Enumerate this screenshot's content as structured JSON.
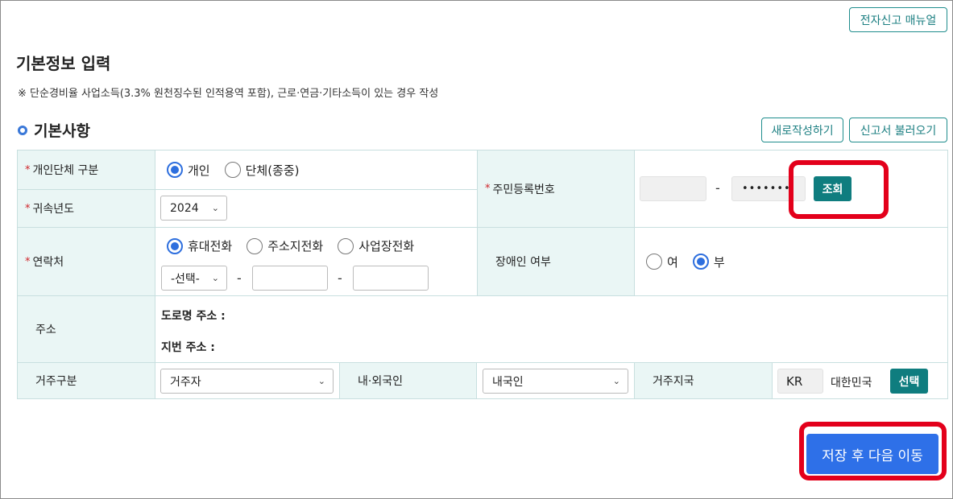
{
  "header": {
    "manual_button": "전자신고 매뉴얼"
  },
  "page": {
    "title": "기본정보 입력",
    "note": "※ 단순경비율 사업소득(3.3% 원천징수된 인적용역 포함), 근로·연금·기타소득이 있는 경우 작성"
  },
  "section": {
    "title": "기본사항",
    "new_button": "새로작성하기",
    "load_button": "신고서 불러오기"
  },
  "form": {
    "required_mark": "*",
    "person_type": {
      "label": "개인단체 구분",
      "options": [
        "개인",
        "단체(종중)"
      ],
      "selected": "개인"
    },
    "year": {
      "label": "귀속년도",
      "value": "2024"
    },
    "resident_no": {
      "label": "주민등록번호",
      "masked": "•••••••",
      "lookup_button": "조회"
    },
    "contact": {
      "label": "연락처",
      "options": [
        "휴대전화",
        "주소지전화",
        "사업장전화"
      ],
      "selected": "휴대전화",
      "area_select": "-선택-",
      "separator": "-"
    },
    "disability": {
      "label": "장애인 여부",
      "options": [
        "여",
        "부"
      ],
      "selected": "부"
    },
    "address": {
      "label": "주소",
      "road": "도로명 주소 :",
      "lot": "지번 주소 :"
    },
    "residence": {
      "label": "거주구분",
      "value": "거주자"
    },
    "nationality": {
      "label": "내·외국인",
      "value": "내국인"
    },
    "residence_country": {
      "label": "거주지국",
      "code": "KR",
      "name": "대한민국",
      "select_button": "선택"
    }
  },
  "footer": {
    "save_next_button": "저장 후 다음 이동"
  },
  "colors": {
    "accent": "#0f7d7f",
    "primary": "#2e70e8",
    "highlight": "#e3001b",
    "label_bg": "#eaf6f5"
  }
}
